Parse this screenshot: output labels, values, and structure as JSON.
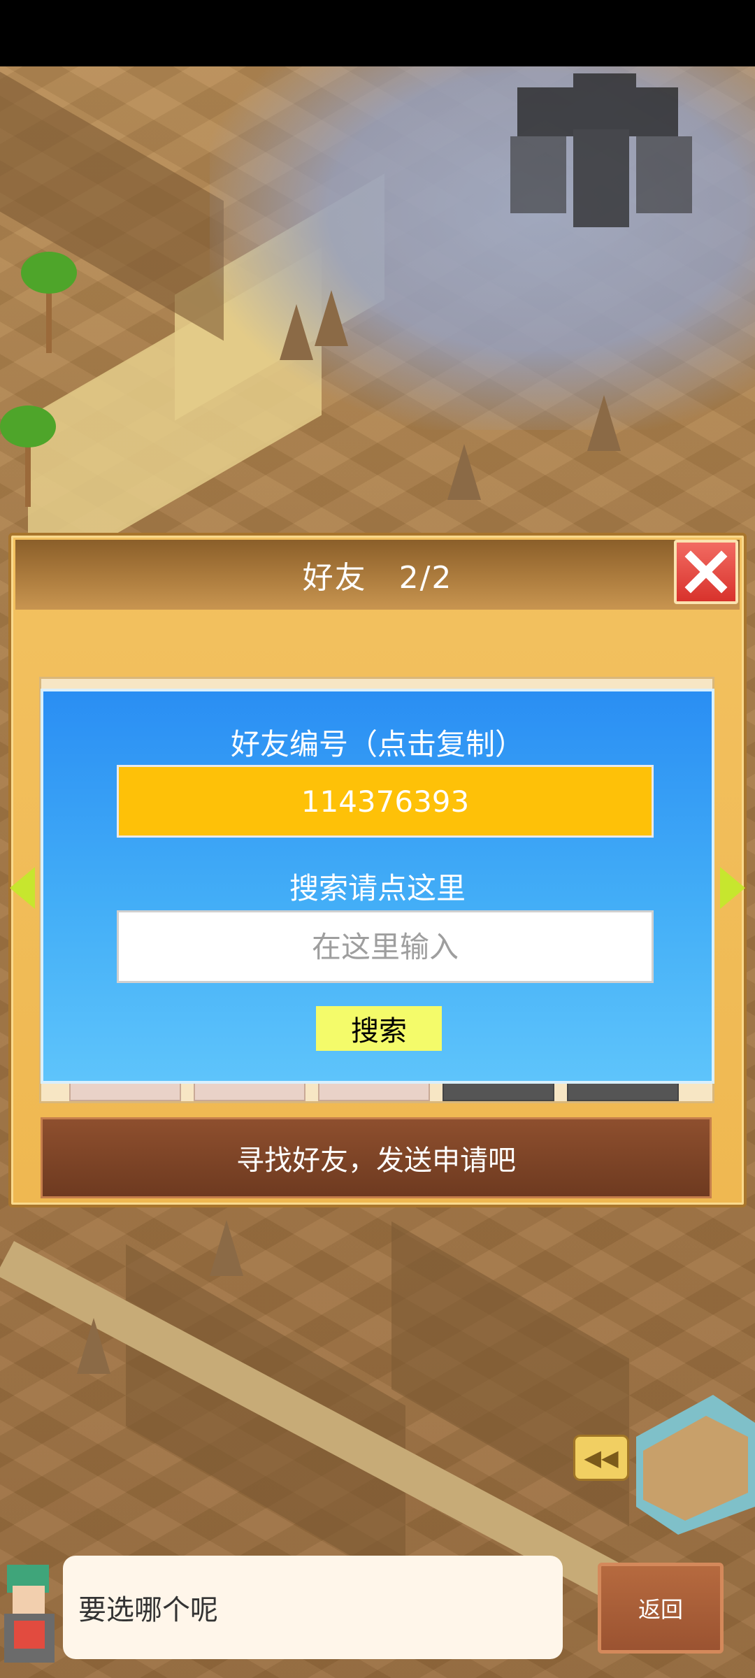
{
  "dialog": {
    "title": "好友　2/2",
    "friend_id_label": "好友编号（点击复制）",
    "friend_id": "114376393",
    "search_label": "搜索请点这里",
    "search_placeholder": "在这里输入",
    "search_button": "搜索",
    "find_friends_banner": "寻找好友，发送申请吧"
  },
  "bottom": {
    "speech_text": "要选哪个呢",
    "back_button": "返回"
  },
  "colors": {
    "dialog_bg": "#efb851",
    "panel_blue": "#2a8ef3",
    "id_box": "#fec108",
    "search_button": "#f4fb6a",
    "close_red": "#d8322c",
    "banner_brown": "#6e3a20"
  },
  "icons": [
    "close-icon",
    "arrow-left-icon",
    "arrow-right-icon",
    "replay-icon"
  ]
}
